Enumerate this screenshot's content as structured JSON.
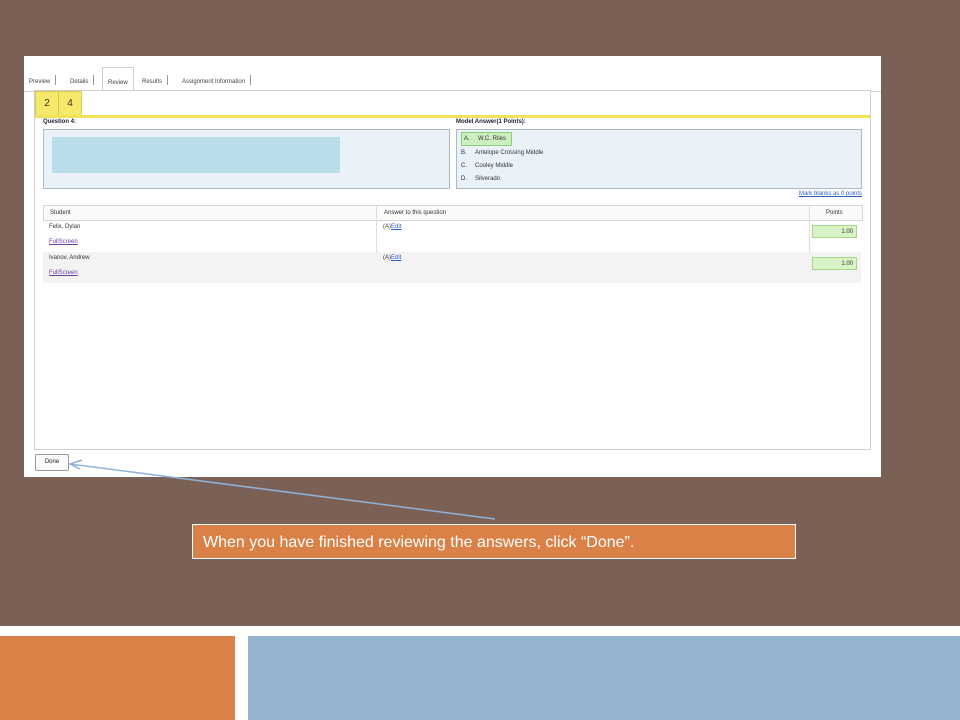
{
  "tabs": [
    {
      "label": "Preview"
    },
    {
      "label": "Details"
    },
    {
      "label": "Review"
    },
    {
      "label": "Results"
    },
    {
      "label": "Assignment Information"
    }
  ],
  "question_nav": [
    "2",
    "4"
  ],
  "question": {
    "label": "Question 4:"
  },
  "model_answer": {
    "label": "Model Answer(1 Points):",
    "options": [
      {
        "letter": "A.",
        "text": "W.C. Riles"
      },
      {
        "letter": "B.",
        "text": "Antelope Crossing Middle"
      },
      {
        "letter": "C.",
        "text": "Cooley Middle"
      },
      {
        "letter": "D.",
        "text": "Silverado"
      }
    ]
  },
  "mark_blanks_link": "Mark blanks as 0 points",
  "table": {
    "headers": {
      "student": "Student",
      "answer": "Answer to this question",
      "points": "Points"
    },
    "rows": [
      {
        "student": "Felix, Dylan",
        "fullscreen": "FullScreen",
        "answer": "(A)",
        "edit": "Edit",
        "points": "1.00"
      },
      {
        "student": "Ivanov, Andrew",
        "fullscreen": "FullScreen",
        "answer": "(A)",
        "edit": "Edit",
        "points": "1.00"
      }
    ]
  },
  "done_button": "Done",
  "callout_text": "When you have finished reviewing the answers, click “Done”.",
  "colors": {
    "slide_background": "#7b6055",
    "callout": "#d98147",
    "footer_blue": "#93b3cf",
    "question_tab": "#f6e86a",
    "correct_answer": "#cdeec0"
  }
}
